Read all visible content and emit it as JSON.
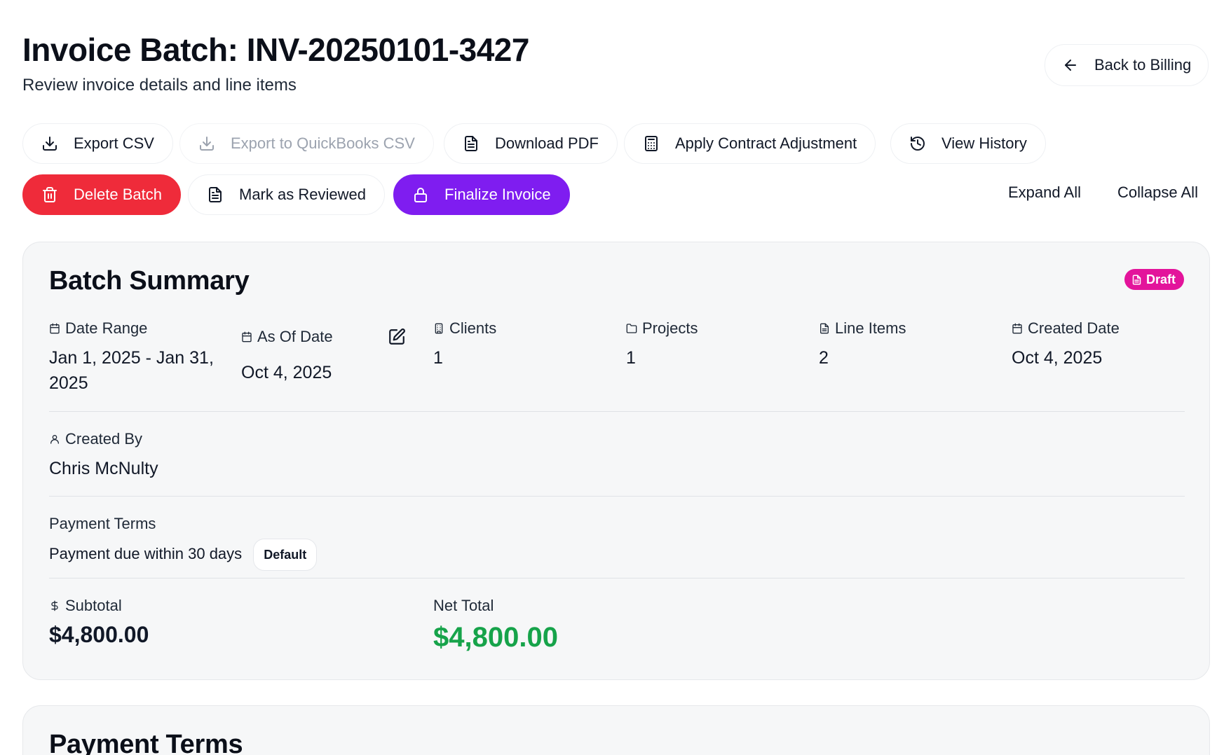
{
  "header": {
    "title": "Invoice Batch: INV-20250101-3427",
    "subtitle": "Review invoice details and line items",
    "back_label": "Back to Billing"
  },
  "toolbar": {
    "export_csv": "Export CSV",
    "export_quickbooks": "Export to QuickBooks CSV",
    "download_pdf": "Download PDF",
    "apply_adjustment": "Apply Contract Adjustment",
    "view_history": "View History",
    "delete_batch": "Delete Batch",
    "mark_reviewed": "Mark as Reviewed",
    "finalize_invoice": "Finalize Invoice",
    "expand_all": "Expand All",
    "collapse_all": "Collapse All"
  },
  "summary": {
    "title": "Batch Summary",
    "status": "Draft",
    "date_range_label": "Date Range",
    "date_range_value": "Jan 1, 2025 - Jan 31, 2025",
    "as_of_label": "As Of Date",
    "as_of_value": "Oct 4, 2025",
    "clients_label": "Clients",
    "clients_value": "1",
    "projects_label": "Projects",
    "projects_value": "1",
    "line_items_label": "Line Items",
    "line_items_value": "2",
    "created_date_label": "Created Date",
    "created_date_value": "Oct 4, 2025",
    "created_by_label": "Created By",
    "created_by_value": "Chris McNulty",
    "payment_terms_label": "Payment Terms",
    "payment_terms_value": "Payment due within 30 days",
    "payment_terms_badge": "Default",
    "subtotal_label": "Subtotal",
    "subtotal_value": "$4,800.00",
    "net_total_label": "Net Total",
    "net_total_value": "$4,800.00"
  },
  "payment_terms_section": {
    "title": "Payment Terms"
  },
  "colors": {
    "danger": "#ef2b3a",
    "primary": "#7f1df0",
    "draft_badge": "#e3149b",
    "net_total": "#16a34a"
  }
}
